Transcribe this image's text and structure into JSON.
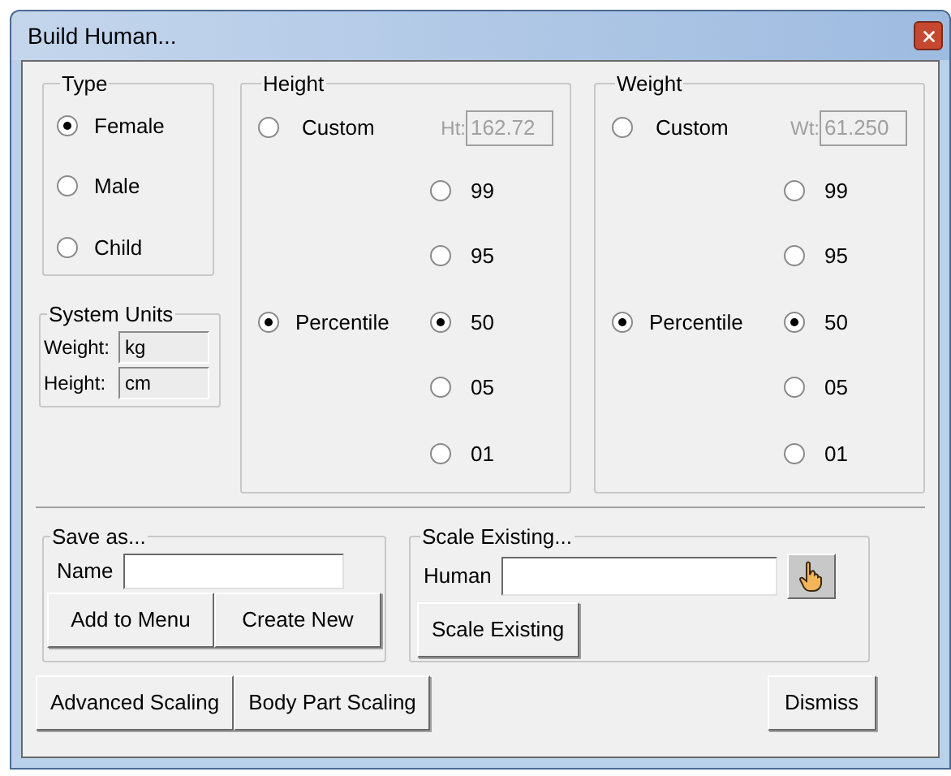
{
  "window": {
    "title": "Build Human..."
  },
  "type": {
    "label": "Type",
    "options": [
      {
        "label": "Female",
        "selected": true
      },
      {
        "label": "Male",
        "selected": false
      },
      {
        "label": "Child",
        "selected": false
      }
    ]
  },
  "system_units": {
    "label": "System Units",
    "fields": [
      {
        "label": "Weight:",
        "value": "kg"
      },
      {
        "label": "Height:",
        "value": "cm"
      }
    ]
  },
  "measures": [
    {
      "label": "Height",
      "modes": [
        {
          "label": "Custom",
          "selected": false
        },
        {
          "label": "Percentile",
          "selected": true
        }
      ],
      "field": {
        "label": "Ht:",
        "value": "162.72",
        "disabled": true
      },
      "percentiles": [
        {
          "label": "99",
          "selected": false
        },
        {
          "label": "95",
          "selected": false
        },
        {
          "label": "50",
          "selected": true
        },
        {
          "label": "05",
          "selected": false
        },
        {
          "label": "01",
          "selected": false
        }
      ]
    },
    {
      "label": "Weight",
      "modes": [
        {
          "label": "Custom",
          "selected": false
        },
        {
          "label": "Percentile",
          "selected": true
        }
      ],
      "field": {
        "label": "Wt:",
        "value": "61.250",
        "disabled": true
      },
      "percentiles": [
        {
          "label": "99",
          "selected": false
        },
        {
          "label": "95",
          "selected": false
        },
        {
          "label": "50",
          "selected": true
        },
        {
          "label": "05",
          "selected": false
        },
        {
          "label": "01",
          "selected": false
        }
      ]
    }
  ],
  "save_as": {
    "label": "Save as...",
    "name_label": "Name",
    "buttons": [
      "Add to Menu",
      "Create New"
    ]
  },
  "scale_existing": {
    "label": "Scale Existing...",
    "human_label": "Human",
    "button": "Scale Existing"
  },
  "buttons": [
    "Advanced Scaling",
    "Body Part Scaling"
  ],
  "dismiss": "Dismiss"
}
